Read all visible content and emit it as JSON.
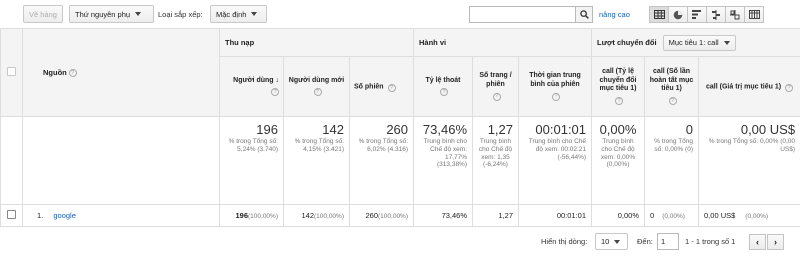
{
  "toolbar": {
    "plot_rows_label": "Vẽ hàng",
    "secondary_dimension_label": "Thứ nguyên phụ",
    "sort_type_label": "Loại sắp xếp:",
    "sort_type_value": "Mặc định",
    "search_placeholder": "",
    "advanced_link": "nâng cao",
    "view_icons": [
      "data-table-icon",
      "pie-chart-icon",
      "performance-icon",
      "comparison-icon",
      "term-cloud-icon",
      "pivot-icon"
    ]
  },
  "table": {
    "source_header": "Nguồn",
    "groups": {
      "acquisition": "Thu nạp",
      "behavior": "Hành vi",
      "conversions": "Lượt chuyển đổi",
      "goal_select": "Mục tiêu 1: call"
    },
    "columns": [
      "Người dùng",
      "Người dùng mới",
      "Số phiên",
      "Tỷ lệ thoát",
      "Số trang / phiên",
      "Thời gian trung bình của phiên",
      "call (Tỷ lệ chuyển đổi mục tiêu 1)",
      "call (Số lần hoàn tất mục tiêu 1)",
      "call (Giá trị mục tiêu 1)"
    ],
    "totals": [
      {
        "value": "196",
        "sub": "% trong Tổng số: 5,24% (3.740)"
      },
      {
        "value": "142",
        "sub": "% trong Tổng số: 4,15% (3.421)"
      },
      {
        "value": "260",
        "sub": "% trong Tổng số: 6,02% (4.316)"
      },
      {
        "value": "73,46%",
        "sub": "Trung bình cho Chế độ xem: 17,77% (313,38%)"
      },
      {
        "value": "1,27",
        "sub": "Trung bình cho Chế độ xem: 1,35 (-6,24%)"
      },
      {
        "value": "00:01:01",
        "sub": "Trung bình cho Chế độ xem: 00:02:21 (-56,44%)"
      },
      {
        "value": "0,00%",
        "sub": "Trung bình cho Chế độ xem: 0,00% (0,00%)"
      },
      {
        "value": "0",
        "sub": "% trong Tổng số: 0,00% (0)"
      },
      {
        "value": "0,00 US$",
        "sub": "% trong Tổng số: 0,00% (0,00 US$)"
      }
    ],
    "rows": [
      {
        "index": "1.",
        "source": "google",
        "users": "196",
        "users_pct": "(100,00%)",
        "new_users": "142",
        "new_users_pct": "(100,00%)",
        "sessions": "260",
        "sessions_pct": "(100,00%)",
        "bounce_rate": "73,46%",
        "pages_per_session": "1,27",
        "avg_duration": "00:01:01",
        "conv_rate": "0,00%",
        "completions": "0",
        "completions_pct": "(0,00%)",
        "goal_value": "0,00 US$",
        "goal_value_pct": "(0,00%)"
      }
    ]
  },
  "footer": {
    "show_rows_label": "Hiển thị dòng:",
    "show_rows_value": "10",
    "goto_label": "Đến:",
    "goto_value": "1",
    "range_text": "1 - 1 trong số 1",
    "prev": "‹",
    "next": "›"
  }
}
